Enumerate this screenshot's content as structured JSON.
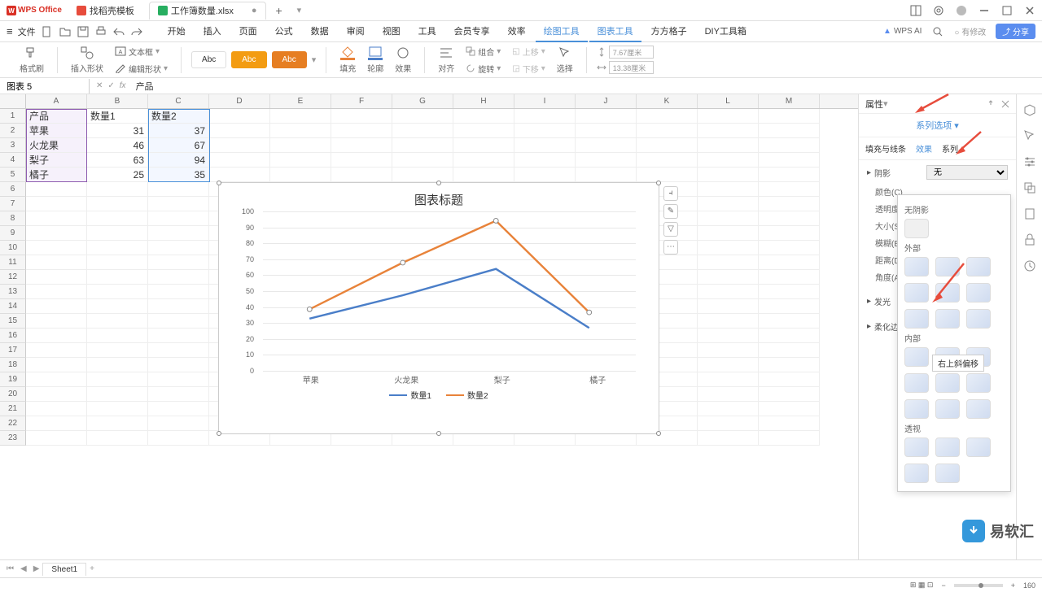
{
  "app": {
    "name": "WPS Office"
  },
  "tabs": [
    {
      "label": "找稻壳模板",
      "icon": "red"
    },
    {
      "label": "工作簿数量.xlsx",
      "icon": "green",
      "active": true
    }
  ],
  "menu": {
    "file": "文件",
    "items": [
      "开始",
      "插入",
      "页面",
      "公式",
      "数据",
      "审阅",
      "视图",
      "工具",
      "会员专享",
      "效率",
      "绘图工具",
      "图表工具",
      "方方格子",
      "DIY工具箱"
    ],
    "active": "绘图工具",
    "wpsai": "WPS AI",
    "changes": "有修改",
    "share": "分享"
  },
  "ribbon": {
    "format_painter": "格式刷",
    "insert_shape": "插入形状",
    "edit_shape": "编辑形状",
    "text_box": "文本框",
    "abc": "Abc",
    "fill": "填充",
    "outline": "轮廓",
    "effect": "效果",
    "align": "对齐",
    "group": "组合",
    "rotate": "旋转",
    "move_up": "上移",
    "move_down": "下移",
    "select": "选择",
    "height": "7.67厘米",
    "width": "13.38厘米"
  },
  "name_box": "图表 5",
  "formula": "产品",
  "columns": [
    "A",
    "B",
    "C",
    "D",
    "E",
    "F",
    "G",
    "H",
    "I",
    "J",
    "K",
    "L",
    "M"
  ],
  "rows_count": 23,
  "table": {
    "headers": [
      "产品",
      "数量1",
      "数量2"
    ],
    "data": [
      [
        "苹果",
        31,
        37
      ],
      [
        "火龙果",
        46,
        67
      ],
      [
        "梨子",
        63,
        94
      ],
      [
        "橘子",
        25,
        35
      ]
    ]
  },
  "chart_data": {
    "type": "line",
    "title": "图表标题",
    "categories": [
      "苹果",
      "火龙果",
      "梨子",
      "橘子"
    ],
    "series": [
      {
        "name": "数量1",
        "values": [
          31,
          46,
          63,
          25
        ],
        "color": "#4a7ec8"
      },
      {
        "name": "数量2",
        "values": [
          37,
          67,
          94,
          35
        ],
        "color": "#e8833a"
      }
    ],
    "ylim": [
      0,
      100
    ],
    "yticks": [
      0,
      10,
      20,
      30,
      40,
      50,
      60,
      70,
      80,
      90,
      100
    ]
  },
  "props": {
    "title": "属性",
    "dropdown": "系列选项",
    "tabs": [
      "填充与线条",
      "效果",
      "系列"
    ],
    "active_tab": "效果",
    "shadow": {
      "label": "阴影",
      "value": "无",
      "color": "颜色(C)",
      "transparency": "透明度(T)",
      "size": "大小(S)",
      "blur": "模糊(B)",
      "distance": "距离(D)",
      "angle": "角度(A)"
    },
    "glow": "发光",
    "soft_edge": "柔化边缘",
    "popup": {
      "none": "无阴影",
      "outer": "外部",
      "inner": "内部",
      "perspective": "透视",
      "tooltip": "右上斜偏移"
    }
  },
  "sheet_tabs": {
    "sheet1": "Sheet1"
  },
  "status": {
    "zoom": "160"
  },
  "watermark": "易软汇"
}
